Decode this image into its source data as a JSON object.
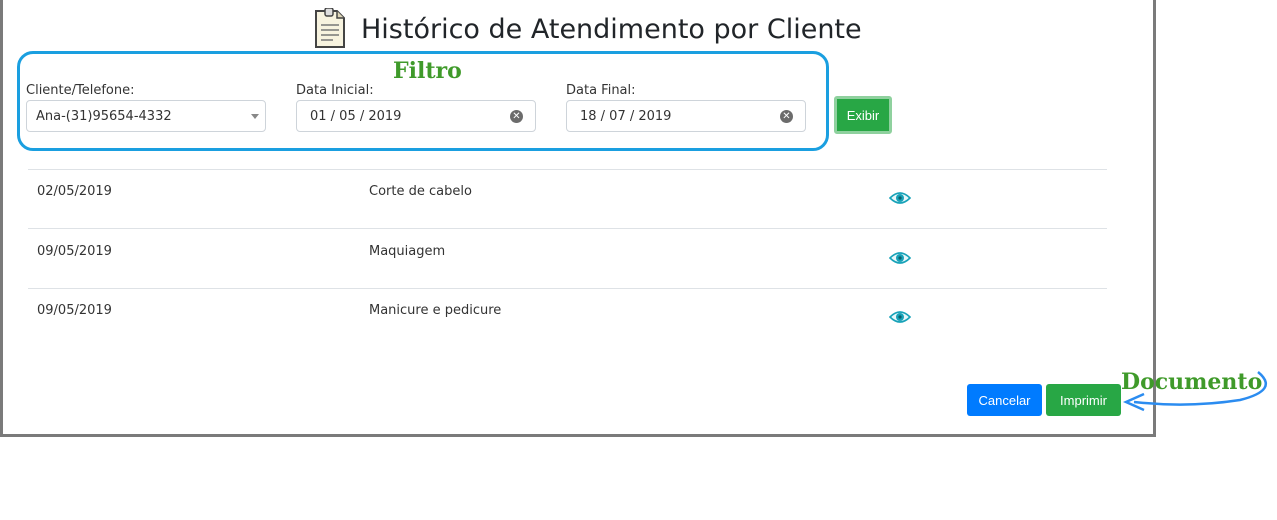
{
  "header": {
    "title": "Histórico de Atendimento por Cliente",
    "icon": "document-icon"
  },
  "annotations": {
    "filter": "Filtro",
    "document": "Documento"
  },
  "filter": {
    "client_label": "Cliente/Telefone:",
    "client_value": "Ana-(31)95654-4332",
    "start_label": "Data Inicial:",
    "start_value": "01 / 05 / 2019",
    "end_label": "Data Final:",
    "end_value": "18 / 07 / 2019",
    "show_button": "Exibir"
  },
  "rows": [
    {
      "date": "02/05/2019",
      "service": "Corte de cabelo"
    },
    {
      "date": "09/05/2019",
      "service": "Maquiagem"
    },
    {
      "date": "09/05/2019",
      "service": "Manicure e pedicure"
    }
  ],
  "footer": {
    "cancel": "Cancelar",
    "print": "Imprimir"
  },
  "colors": {
    "green": "#28a745",
    "blue": "#007bff",
    "highlight": "#1a9fe0",
    "annotation": "#3f9a2a",
    "eye": "#17a2b8"
  }
}
